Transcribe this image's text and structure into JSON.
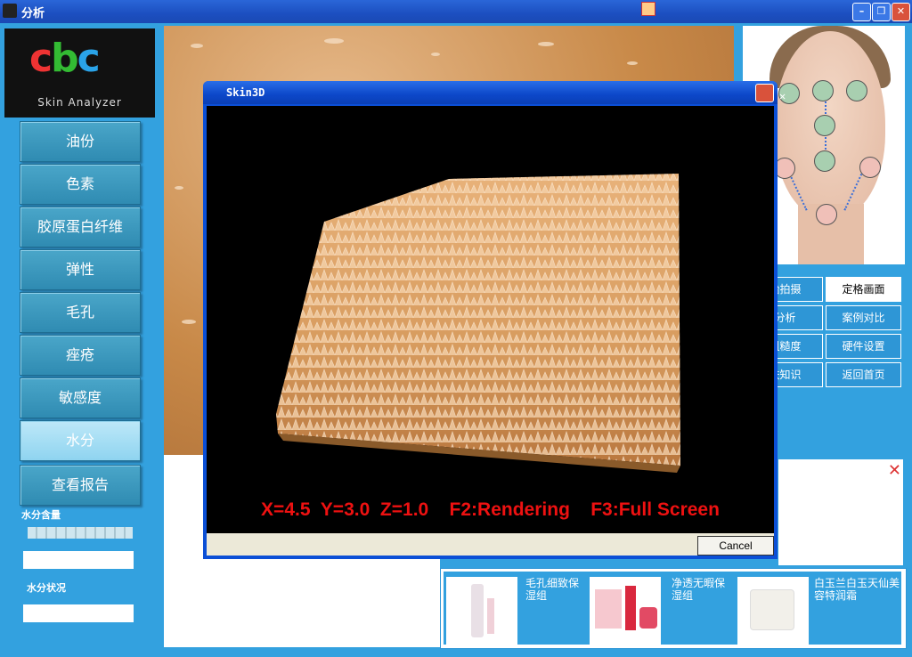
{
  "window": {
    "title": "分析",
    "icons": {
      "app": "app-icon",
      "minimize": "minimize-icon",
      "restore": "restore-icon",
      "close": "close-icon"
    }
  },
  "logo": {
    "letters": "cbc",
    "subtitle": "Skin Analyzer"
  },
  "nav": {
    "items": [
      {
        "label": "油份"
      },
      {
        "label": "色素"
      },
      {
        "label": "胶原蛋白纤维"
      },
      {
        "label": "弹性"
      },
      {
        "label": "毛孔"
      },
      {
        "label": "痤疮"
      },
      {
        "label": "敏感度"
      },
      {
        "label": "水分",
        "active": true
      },
      {
        "label": "查看报告"
      }
    ]
  },
  "moisture": {
    "content_label": "水分含量",
    "status_label": "水分状况"
  },
  "right_buttons": [
    {
      "label": "始拍摄"
    },
    {
      "label": "定格画面",
      "highlight": true
    },
    {
      "label": "分析"
    },
    {
      "label": "案例对比"
    },
    {
      "label": "粗糙度"
    },
    {
      "label": "硬件设置"
    },
    {
      "label": "肤知识"
    },
    {
      "label": "返回首页"
    }
  ],
  "products": [
    {
      "name": "毛孔细致保湿组"
    },
    {
      "name": "净透无暇保湿组"
    },
    {
      "name": "白玉兰白玉天仙美容特润霜"
    }
  ],
  "dialog": {
    "title": "Skin3D",
    "status_text": "X=4.5  Y=3.0  Z=1.0    F2:Rendering    F3:Full Screen",
    "cancel_label": "Cancel"
  },
  "colors": {
    "accent": "#33a1df",
    "status_text": "#e11111",
    "surface_3d": "#d79b5e"
  }
}
